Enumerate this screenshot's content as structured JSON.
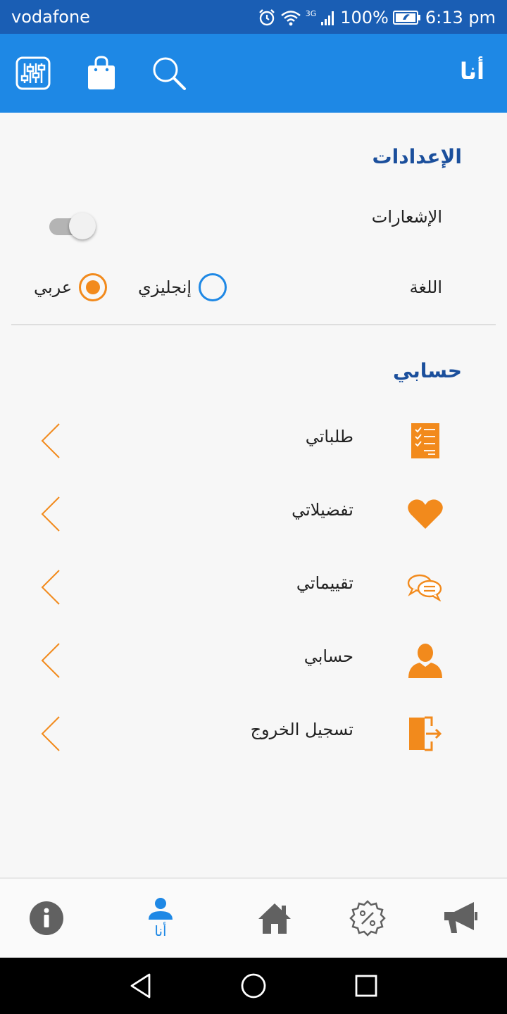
{
  "status_bar": {
    "carrier": "vodafone",
    "network": "3G",
    "battery": "100%",
    "time": "6:13 pm"
  },
  "app_bar": {
    "title": "أنا",
    "icons": [
      "filters-icon",
      "shopping-bag-icon",
      "search-icon"
    ]
  },
  "settings": {
    "title": "الإعدادات",
    "notifications_label": "الإشعارات",
    "notifications_on": false,
    "language_label": "اللغة",
    "language_options": [
      "عربي",
      "إنجليزي"
    ],
    "language_selected": "عربي"
  },
  "account": {
    "title": "حسابي",
    "items": [
      {
        "label": "طلباتي",
        "icon": "orders-checklist-icon"
      },
      {
        "label": "تفضيلاتي",
        "icon": "heart-icon"
      },
      {
        "label": "تقييماتي",
        "icon": "reviews-chat-icon"
      },
      {
        "label": "حسابي",
        "icon": "user-icon"
      },
      {
        "label": "تسجيل الخروج",
        "icon": "logout-door-icon"
      }
    ]
  },
  "bottom_nav": {
    "items": [
      {
        "icon": "info-icon",
        "label": ""
      },
      {
        "icon": "user-icon",
        "label": "أنا",
        "active": true
      },
      {
        "icon": "home-icon",
        "label": ""
      },
      {
        "icon": "discount-badge-icon",
        "label": ""
      },
      {
        "icon": "megaphone-icon",
        "label": ""
      }
    ]
  },
  "colors": {
    "status_bar": "#1a5eb4",
    "app_bar": "#1e88e5",
    "section_title": "#1b4f9c",
    "accent_orange": "#f28a1c",
    "radio_blue": "#1e88e5",
    "nav_inactive": "#616161"
  }
}
